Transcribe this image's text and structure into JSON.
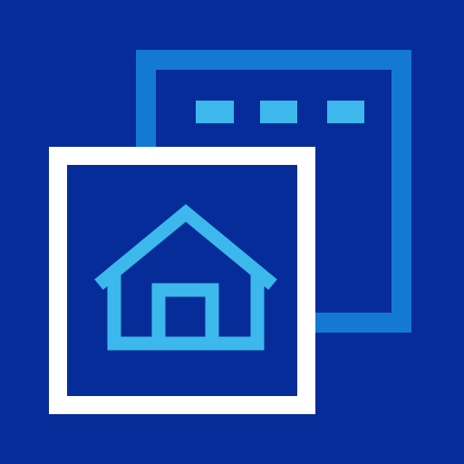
{
  "icon": {
    "name": "home-page-window-icon",
    "colors": {
      "background": "#062c99",
      "back_window_frame": "#1479d3",
      "window_dots": "#3cb8ec",
      "front_window_frame": "#ffffff",
      "house_stroke": "#3cb8ec"
    },
    "parts": [
      "back-window-icon",
      "window-dots-icon",
      "front-window-icon",
      "house-icon"
    ]
  }
}
